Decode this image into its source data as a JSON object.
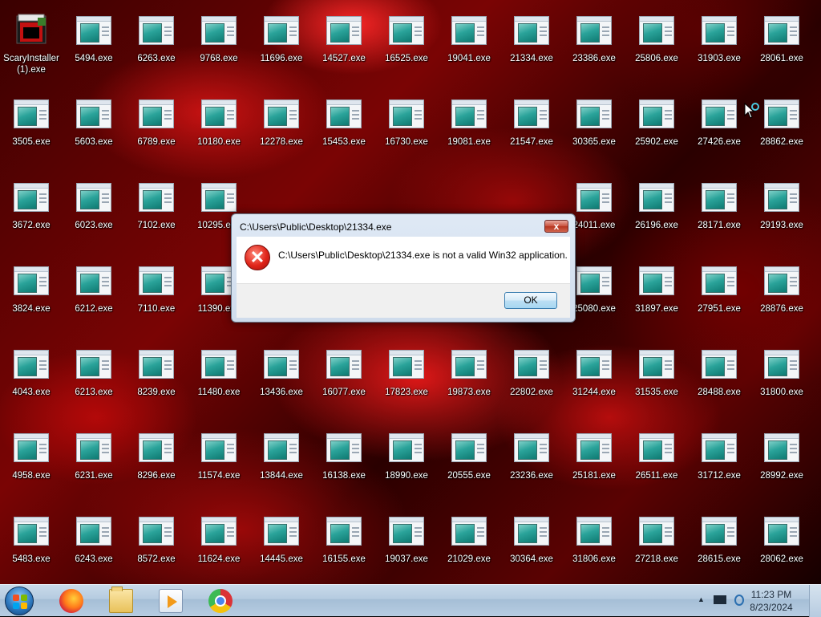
{
  "desktop": {
    "icons": [
      [
        "ScaryInstaller (1).exe",
        "5494.exe",
        "6263.exe",
        "9768.exe",
        "11696.exe",
        "14527.exe",
        "16525.exe",
        "19041.exe",
        "21334.exe",
        "23386.exe",
        "25806.exe",
        "31903.exe",
        "28061.exe"
      ],
      [
        "3505.exe",
        "5603.exe",
        "6789.exe",
        "10180.exe",
        "12278.exe",
        "15453.exe",
        "16730.exe",
        "19081.exe",
        "21547.exe",
        "30365.exe",
        "25902.exe",
        "27426.exe",
        "28862.exe"
      ],
      [
        "3672.exe",
        "6023.exe",
        "7102.exe",
        "10295.exe",
        "",
        "",
        "",
        "",
        "",
        "24011.exe",
        "26196.exe",
        "28171.exe",
        "29193.exe"
      ],
      [
        "3824.exe",
        "6212.exe",
        "7110.exe",
        "11390.exe",
        "",
        "",
        "",
        "",
        "",
        "25080.exe",
        "31897.exe",
        "27951.exe",
        "28876.exe"
      ],
      [
        "4043.exe",
        "6213.exe",
        "8239.exe",
        "11480.exe",
        "13436.exe",
        "16077.exe",
        "17823.exe",
        "19873.exe",
        "22802.exe",
        "31244.exe",
        "31535.exe",
        "28488.exe",
        "31800.exe"
      ],
      [
        "4958.exe",
        "6231.exe",
        "8296.exe",
        "11574.exe",
        "13844.exe",
        "16138.exe",
        "18990.exe",
        "20555.exe",
        "23236.exe",
        "25181.exe",
        "26511.exe",
        "31712.exe",
        "28992.exe"
      ],
      [
        "5483.exe",
        "6243.exe",
        "8572.exe",
        "11624.exe",
        "14445.exe",
        "16155.exe",
        "19037.exe",
        "21029.exe",
        "30364.exe",
        "31806.exe",
        "27218.exe",
        "28615.exe",
        "28062.exe"
      ]
    ]
  },
  "dialog": {
    "title": "C:\\Users\\Public\\Desktop\\21334.exe",
    "close_label": "x",
    "icon": "error-icon",
    "message": "C:\\Users\\Public\\Desktop\\21334.exe is not a valid Win32 application.",
    "ok_label": "OK"
  },
  "taskbar": {
    "pinned": [
      "start-orb",
      "firefox-icon",
      "file-explorer-icon",
      "media-player-icon",
      "chrome-icon"
    ],
    "tray": {
      "show_hidden_label": "▲",
      "clock_time": "11:23 PM",
      "clock_date": "8/23/2024"
    }
  },
  "colors": {
    "taskbar": "#b5cbe0",
    "dialog_frame": "#cfdcec",
    "error_red": "#e0251a"
  }
}
